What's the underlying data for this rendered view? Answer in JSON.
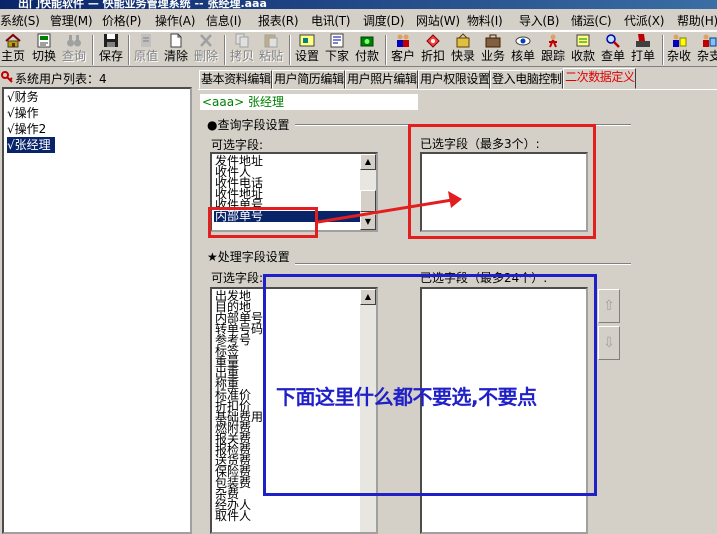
{
  "window": {
    "title": "出门快能软件 — 快能业务管理系统 -- 张经理.aaa"
  },
  "menu": [
    "系统(S)",
    "管理(M)",
    "价格(P)",
    "操作(A)",
    "信息(I)",
    "报表(R)",
    "电讯(T)",
    "调度(D)",
    "网站(W)",
    "物料(I)",
    "导入(B)",
    "储运(C)",
    "代派(X)",
    "帮助(H)"
  ],
  "toolbar": [
    {
      "label": "主页",
      "icon": "home-icon",
      "enabled": true
    },
    {
      "label": "切换",
      "icon": "switch-icon",
      "enabled": true
    },
    {
      "label": "查询",
      "icon": "binoculars-icon",
      "enabled": false
    },
    {
      "label": "保存",
      "icon": "save-icon",
      "enabled": true
    },
    {
      "label": "原值",
      "icon": "undo-icon",
      "enabled": false
    },
    {
      "label": "清除",
      "icon": "clear-icon",
      "enabled": true
    },
    {
      "label": "删除",
      "icon": "delete-icon",
      "enabled": false
    },
    {
      "label": "拷贝",
      "icon": "copy-icon",
      "enabled": false
    },
    {
      "label": "粘贴",
      "icon": "paste-icon",
      "enabled": false
    },
    {
      "label": "设置",
      "icon": "settings-icon",
      "enabled": true
    },
    {
      "label": "下家",
      "icon": "next-icon",
      "enabled": true
    },
    {
      "label": "付款",
      "icon": "payment-icon",
      "enabled": true
    },
    {
      "label": "客户",
      "icon": "customers-icon",
      "enabled": true
    },
    {
      "label": "折扣",
      "icon": "discount-icon",
      "enabled": true
    },
    {
      "label": "快录",
      "icon": "quick-entry-icon",
      "enabled": true
    },
    {
      "label": "业务",
      "icon": "business-icon",
      "enabled": true
    },
    {
      "label": "核单",
      "icon": "verify-icon",
      "enabled": true
    },
    {
      "label": "跟踪",
      "icon": "track-icon",
      "enabled": true
    },
    {
      "label": "收款",
      "icon": "receive-icon",
      "enabled": true
    },
    {
      "label": "查单",
      "icon": "search-order-icon",
      "enabled": true
    },
    {
      "label": "打单",
      "icon": "print-icon",
      "enabled": true
    },
    {
      "label": "杂收",
      "icon": "misc-income-icon",
      "enabled": true
    },
    {
      "label": "杂支",
      "icon": "misc-expense-icon",
      "enabled": true
    }
  ],
  "left_panel": {
    "header": "系统用户列表：4",
    "users": [
      {
        "label": "√财务",
        "selected": false
      },
      {
        "label": "√操作",
        "selected": false
      },
      {
        "label": "√操作2",
        "selected": false
      },
      {
        "label": "√张经理",
        "selected": true
      }
    ]
  },
  "tabs": [
    {
      "label": "基本资料编辑",
      "active": false
    },
    {
      "label": "用户简历编辑",
      "active": false
    },
    {
      "label": "用户照片编辑",
      "active": false
    },
    {
      "label": "用户权限设置",
      "active": false
    },
    {
      "label": "登入电脑控制",
      "active": false
    },
    {
      "label": "二次数据定义",
      "active": true
    }
  ],
  "current_user": "<aaa> 张经理",
  "query_section": {
    "title": "●查询字段设置",
    "available_label": "可选字段:",
    "available_items": [
      "发件地址",
      "收件人",
      "收件电话",
      "收件地址",
      "收件单号",
      "内部单号"
    ],
    "selected_index": 5,
    "chosen_label": "已选字段（最多3个）:",
    "chosen_items": []
  },
  "process_section": {
    "title": "★处理字段设置",
    "available_label": "可选字段:",
    "available_items": [
      "出发地",
      "目的地",
      "内部单号",
      "转单号码",
      "参考号",
      "标签",
      "重量",
      "出重",
      "称重",
      "标准价",
      "折扣价",
      "基础费用",
      "燃附费",
      "报关费",
      "报检费",
      "送货费",
      "保险费",
      "包装费",
      "杂费",
      "经办人",
      "取件人"
    ],
    "chosen_label": "已选字段（最多24个）:",
    "chosen_items": []
  },
  "annotation": {
    "note": "下面这里什么都不要选,不要点",
    "red_color": "#e21e1e",
    "blue_color": "#2020c8"
  },
  "colors": {
    "selection": "#0a246a",
    "face": "#d4d0c8",
    "active_tab_text": "#e00000"
  }
}
